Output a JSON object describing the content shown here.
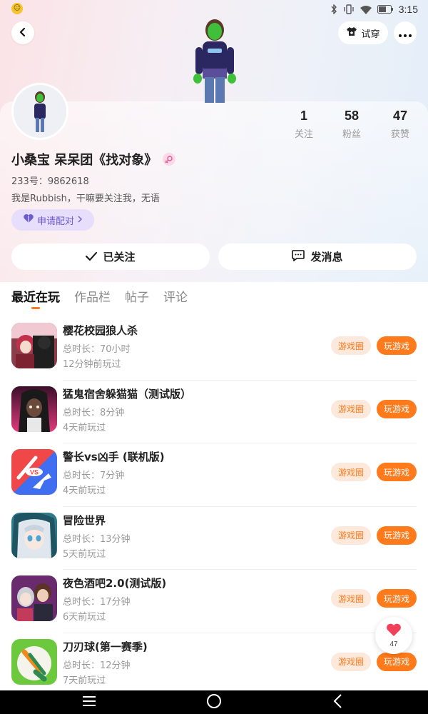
{
  "status_bar": {
    "time": "3:15"
  },
  "header": {
    "tryon_label": "试穿"
  },
  "profile": {
    "stats": [
      {
        "num": "1",
        "label": "关注"
      },
      {
        "num": "58",
        "label": "粉丝"
      },
      {
        "num": "47",
        "label": "获赞"
      }
    ],
    "name": "小桑宝 呆呆团《找对象》",
    "id_text": "233号：9862618",
    "bio": "我是Rubbish，干嘛要关注我，无语",
    "pair_label": "申请配对",
    "follow_label": "已关注",
    "message_label": "发消息"
  },
  "tabs": [
    {
      "label": "最近在玩",
      "active": true
    },
    {
      "label": "作品栏"
    },
    {
      "label": "帖子"
    },
    {
      "label": "评论"
    }
  ],
  "games": [
    {
      "title": "樱花校园狼人杀",
      "duration": "总时长：70小时",
      "last_played": "12分钟前玩过",
      "circle": "游戏圈",
      "play": "玩游戏"
    },
    {
      "title": "猛鬼宿舍躲猫猫（测试版）",
      "duration": "总时长：8分钟",
      "last_played": "4天前玩过",
      "circle": "游戏圈",
      "play": "玩游戏"
    },
    {
      "title": "警长vs凶手 (联机版)",
      "duration": "总时长：7分钟",
      "last_played": "4天前玩过",
      "circle": "游戏圈",
      "play": "玩游戏"
    },
    {
      "title": "冒险世界",
      "duration": "总时长：13分钟",
      "last_played": "5天前玩过",
      "circle": "游戏圈",
      "play": "玩游戏"
    },
    {
      "title": "夜色酒吧2.0(测试版)",
      "duration": "总时长：17分钟",
      "last_played": "6天前玩过",
      "circle": "游戏圈",
      "play": "玩游戏"
    },
    {
      "title": "刀刃球(第一赛季)",
      "duration": "总时长：12分钟",
      "last_played": "7天前玩过",
      "circle": "游戏圈",
      "play": "玩游戏"
    }
  ],
  "like_float": {
    "count": "47"
  },
  "colors": {
    "accent": "#ff7a1a",
    "pair_bg": "#e6defa",
    "pair_text": "#6d5bd0"
  }
}
